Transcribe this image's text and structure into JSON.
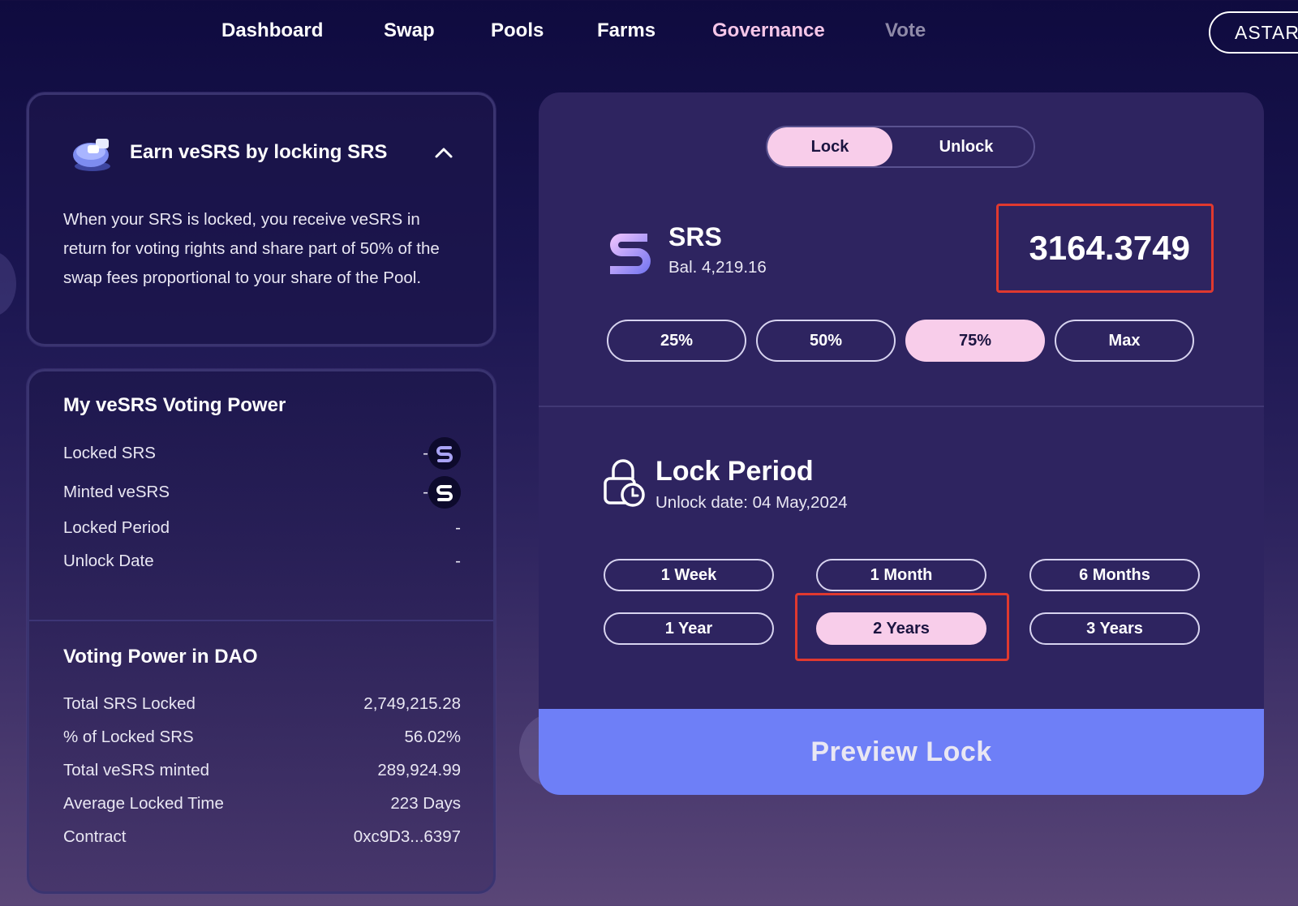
{
  "nav": {
    "items": [
      {
        "label": "Dashboard",
        "style": "default"
      },
      {
        "label": "Swap",
        "style": "default"
      },
      {
        "label": "Pools",
        "style": "default"
      },
      {
        "label": "Farms",
        "style": "default"
      },
      {
        "label": "Governance",
        "style": "pink"
      },
      {
        "label": "Vote",
        "style": "muted"
      }
    ],
    "network_label": "ASTAR"
  },
  "earn_card": {
    "title": "Earn veSRS by locking SRS",
    "description": "When your SRS is locked, you receive veSRS in return for voting rights and share part of 50% of the swap fees proportional to your share of the Pool."
  },
  "my_power": {
    "title": "My veSRS Voting Power",
    "rows": [
      {
        "label": "Locked SRS",
        "value": "-"
      },
      {
        "label": "Minted veSRS",
        "value": "-"
      },
      {
        "label": "Locked Period",
        "value": "-"
      },
      {
        "label": "Unlock Date",
        "value": "-"
      }
    ]
  },
  "dao_power": {
    "title": "Voting Power in DAO",
    "rows": [
      {
        "label": "Total SRS Locked",
        "value": "2,749,215.28"
      },
      {
        "label": "% of Locked SRS",
        "value": "56.02%"
      },
      {
        "label": "Total veSRS minted",
        "value": "289,924.99"
      },
      {
        "label": "Average Locked Time",
        "value": "223 Days"
      },
      {
        "label": "Contract",
        "value": "0xc9D3...6397"
      }
    ]
  },
  "lock_panel": {
    "toggle": {
      "active": "Lock",
      "inactive": "Unlock"
    },
    "token": {
      "name": "SRS",
      "balance": "Bal. 4,219.16"
    },
    "amount": "3164.3749",
    "percent_buttons": [
      "25%",
      "50%",
      "75%",
      "Max"
    ],
    "active_percent": "75%",
    "lock_period": {
      "title": "Lock Period",
      "unlock_date": "Unlock date: 04 May,2024",
      "options": [
        "1 Week",
        "1 Month",
        "6 Months",
        "1 Year",
        "2 Years",
        "3 Years"
      ],
      "selected": "2 Years"
    },
    "preview_label": "Preview Lock"
  },
  "colors": {
    "accent_pink": "#f8cdea",
    "preview_blue": "#6e7ff7",
    "highlight_red": "#e0392f"
  }
}
